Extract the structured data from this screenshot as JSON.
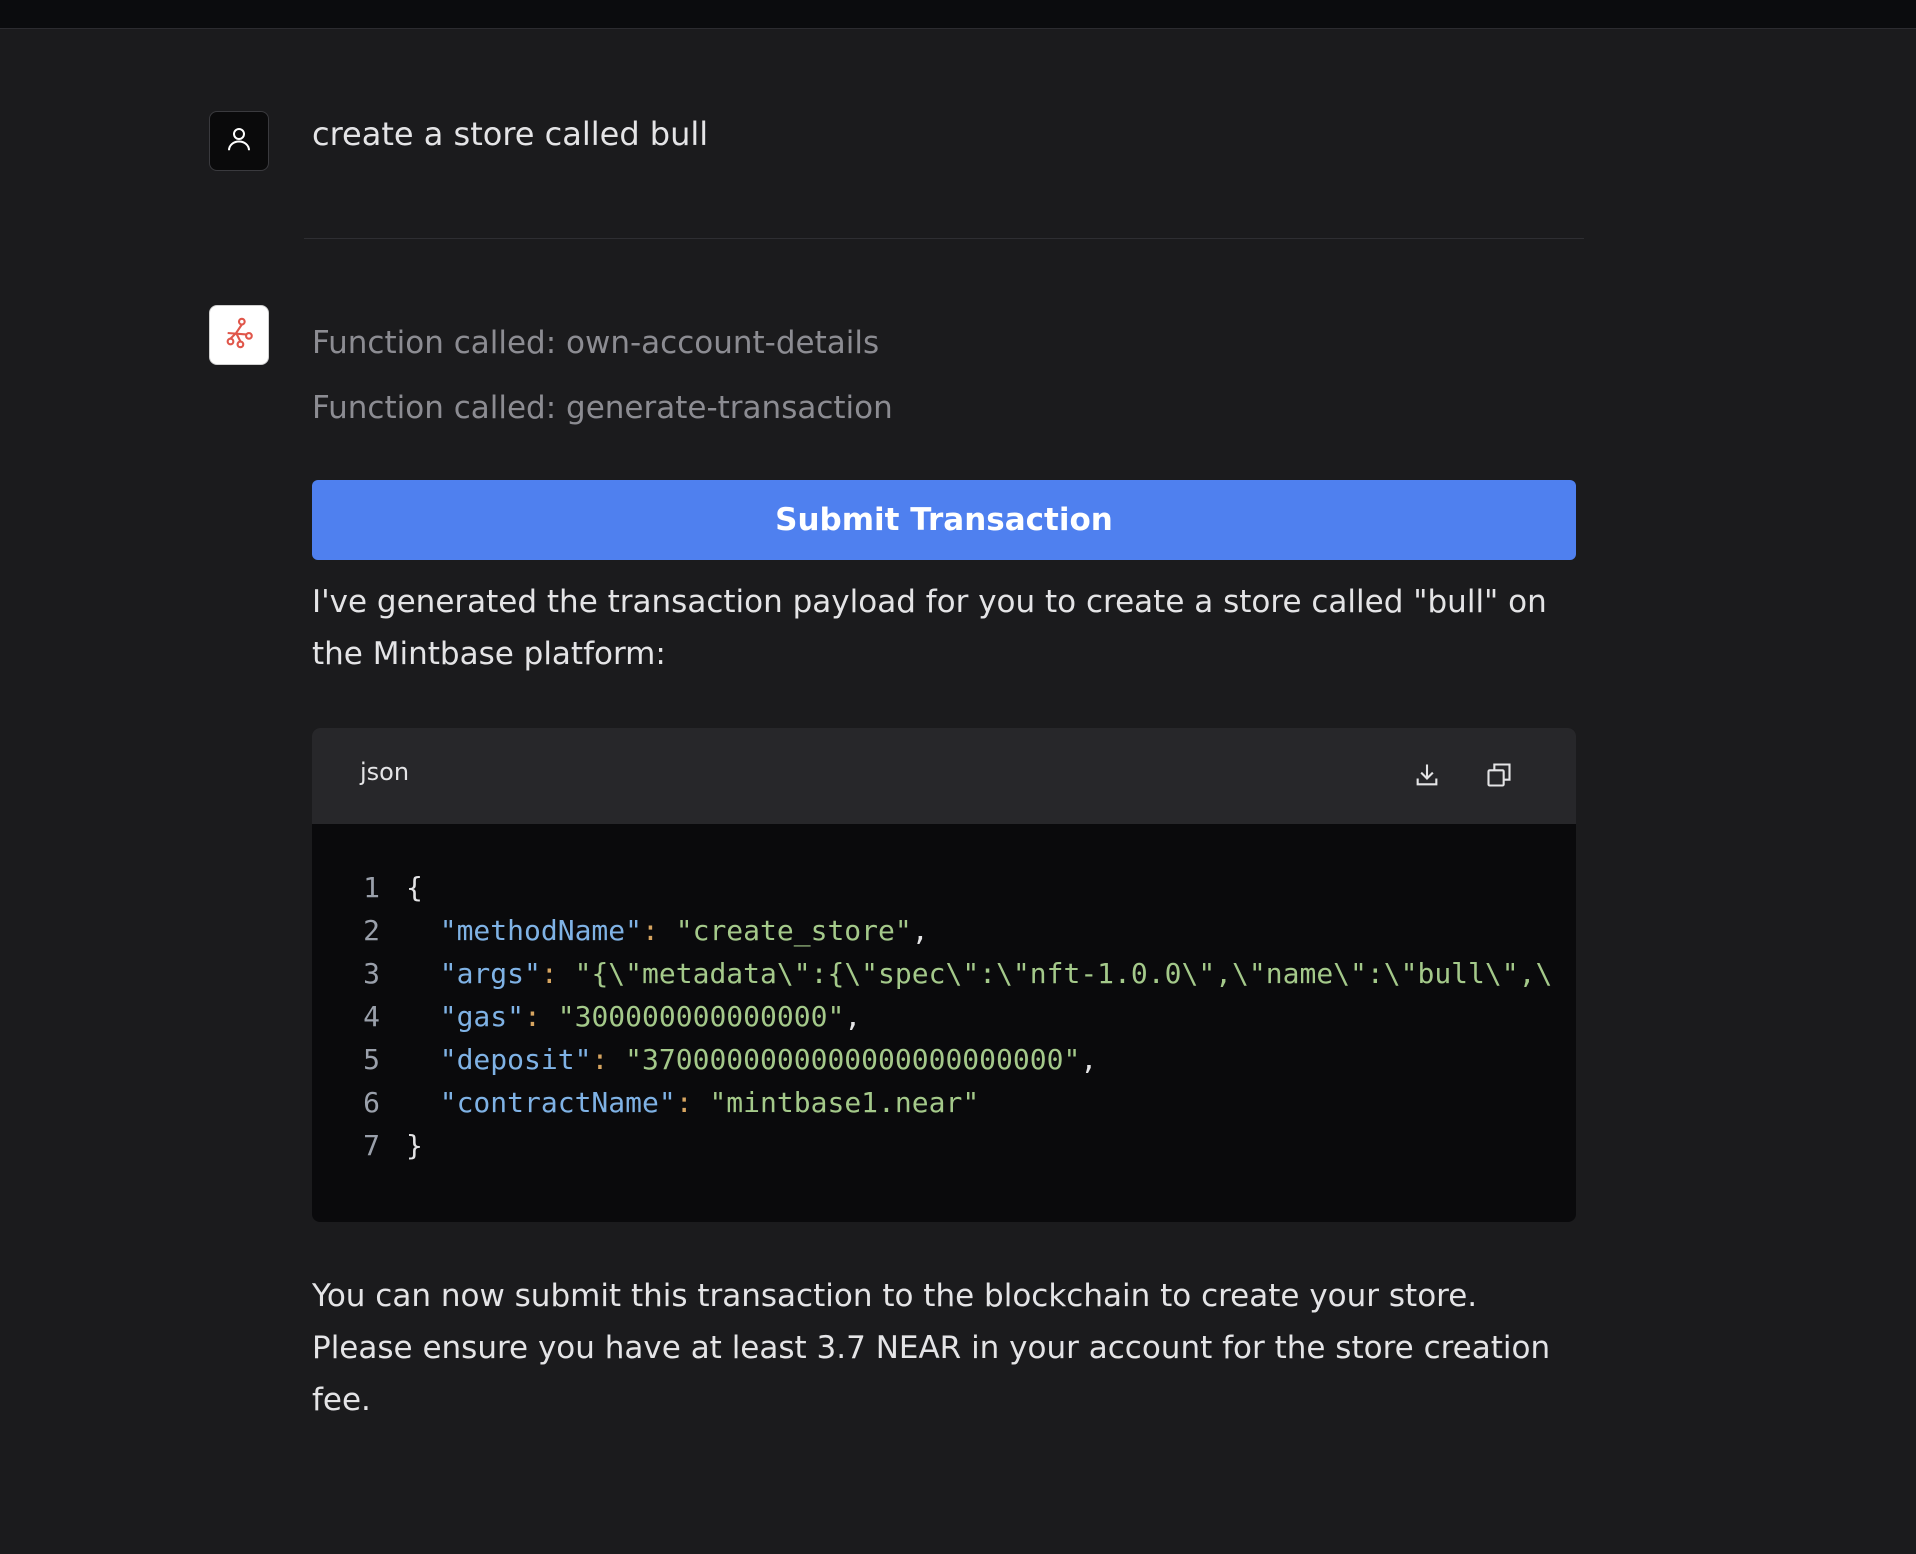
{
  "conversation": {
    "user_message": "create a store called bull",
    "function_calls": [
      "Function called: own-account-details",
      "Function called: generate-transaction"
    ],
    "submit_button_label": "Submit Transaction",
    "intro_text": "I've generated the transaction payload for you to create a store called \"bull\" on the Mintbase platform:",
    "outro_text": "You can now submit this transaction to the blockchain to create your store. Please ensure you have at least 3.7 NEAR in your account for the store creation fee."
  },
  "code_block": {
    "language": "json",
    "icons": [
      "download-icon",
      "copy-icon"
    ],
    "lines": [
      {
        "n": "1",
        "key": "",
        "colon": "",
        "value": "",
        "raw": "{"
      },
      {
        "n": "2",
        "key": "\"methodName\"",
        "colon": ": ",
        "value": "\"create_store\"",
        "trail": ","
      },
      {
        "n": "3",
        "key": "\"args\"",
        "colon": ": ",
        "value": "\"{\\\"metadata\\\":{\\\"spec\\\":\\\"nft-1.0.0\\\",\\\"name\\\":\\\"bull\\\",\\",
        "trail": ""
      },
      {
        "n": "4",
        "key": "\"gas\"",
        "colon": ": ",
        "value": "\"300000000000000\"",
        "trail": ","
      },
      {
        "n": "5",
        "key": "\"deposit\"",
        "colon": ": ",
        "value": "\"3700000000000000000000000\"",
        "trail": ","
      },
      {
        "n": "6",
        "key": "\"contractName\"",
        "colon": ": ",
        "value": "\"mintbase1.near\"",
        "trail": ""
      },
      {
        "n": "7",
        "key": "",
        "colon": "",
        "value": "",
        "raw": "}"
      }
    ]
  },
  "colors": {
    "background": "#1b1b1d",
    "accent_button": "#4f80ef",
    "json_key": "#7fb2e5",
    "json_string": "#a4c98a",
    "bot_icon": "#e0564a"
  }
}
